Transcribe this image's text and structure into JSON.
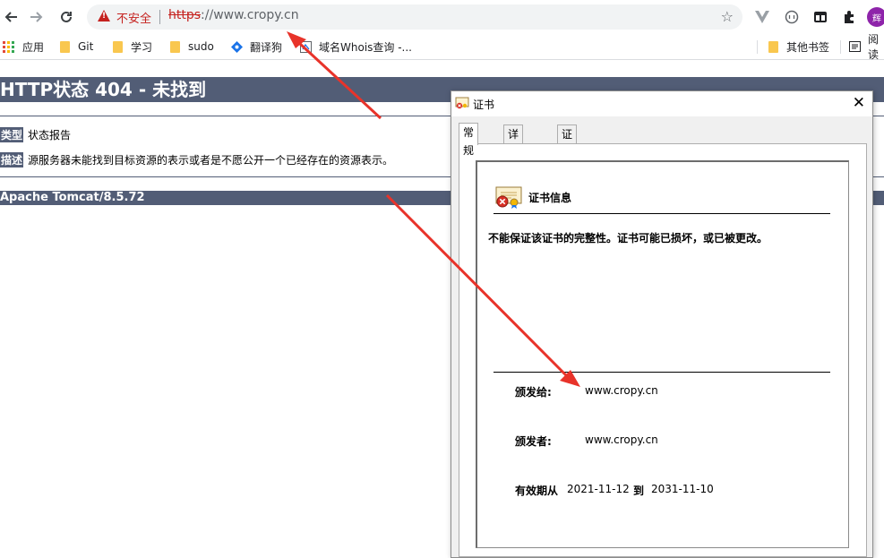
{
  "browser": {
    "insecure_label": "不安全",
    "url_scheme": "https",
    "url_rest": "://www.cropy.cn",
    "avatar_initial": "辉",
    "bookmarks": [
      {
        "label": "应用",
        "type": "apps"
      },
      {
        "label": "Git",
        "type": "folder"
      },
      {
        "label": "学习",
        "type": "folder"
      },
      {
        "label": "sudo",
        "type": "folder"
      },
      {
        "label": "翻译狗",
        "type": "site"
      },
      {
        "label": "域名Whois查询 -...",
        "type": "site"
      },
      {
        "label": "其他书签",
        "type": "folder"
      },
      {
        "label": "阅读",
        "type": "list"
      }
    ]
  },
  "tomcat": {
    "title": "HTTP状态 404 - 未找到",
    "type_key": "类型",
    "type_value": "状态报告",
    "desc_key": "描述",
    "desc_value": "源服务器未能找到目标资源的表示或者是不愿公开一个已经存在的资源表示。",
    "footer": "Apache Tomcat/8.5.72"
  },
  "dialog": {
    "title": "证书",
    "tabs": [
      "常规",
      "详细信息",
      "证书路径"
    ],
    "heading": "证书信息",
    "warning": "不能保证该证书的完整性。证书可能已损坏，或已被更改。",
    "issued_to_label": "颁发给:",
    "issued_to_value": "www.cropy.cn",
    "issued_by_label": "颁发者:",
    "issued_by_value": "www.cropy.cn",
    "valid_from_label": "有效期从",
    "valid_from": "2021-11-12",
    "valid_to_label": "到",
    "valid_to": "2031-11-10"
  },
  "colors": {
    "tomcat_bar": "#525d76",
    "insecure_red": "#c5221f",
    "annotation_red": "#e8332a"
  }
}
